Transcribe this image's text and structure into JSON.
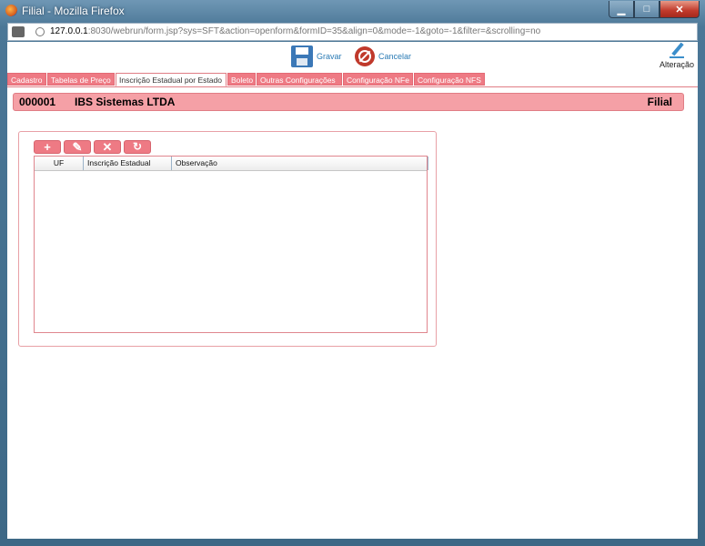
{
  "window": {
    "title": "Filial - Mozilla Firefox",
    "buttons": {
      "minimize": "▁",
      "maximize": "□",
      "close": "✕"
    }
  },
  "address_bar": {
    "host": "127.0.0.1",
    "rest": ":8030/webrun/form.jsp?sys=SFT&action=openform&formID=35&align=0&mode=-1&goto=-1&filter=&scrolling=no"
  },
  "toolbar": {
    "save_label": "Gravar",
    "cancel_label": "Cancelar",
    "mode_label": "Alteração",
    "icons": [
      "save-icon",
      "cancel-icon",
      "pencil-icon"
    ]
  },
  "tabs": [
    {
      "label": "Cadastro",
      "active": false
    },
    {
      "label": "Tabelas de Preço",
      "active": false
    },
    {
      "label": "Inscrição Estadual por Estado",
      "active": true
    },
    {
      "label": "Boleto",
      "active": false
    },
    {
      "label": "Outras Configurações",
      "active": false
    },
    {
      "label": "Configuração NFe",
      "active": false
    },
    {
      "label": "Configuração NFS",
      "active": false
    }
  ],
  "record": {
    "code": "000001",
    "name": "IBS Sistemas LTDA",
    "form_name": "Filial"
  },
  "grid": {
    "actions": [
      {
        "name": "add",
        "glyph": "+"
      },
      {
        "name": "edit",
        "glyph": "✎"
      },
      {
        "name": "delete",
        "glyph": "✕"
      },
      {
        "name": "refresh",
        "glyph": "↻"
      }
    ],
    "columns": [
      "UF",
      "Inscrição Estadual",
      "Observação"
    ],
    "rows": []
  },
  "colors": {
    "accent": "#ee7a84",
    "header_bg": "#f5a0a6",
    "link": "#2a7bb5"
  }
}
